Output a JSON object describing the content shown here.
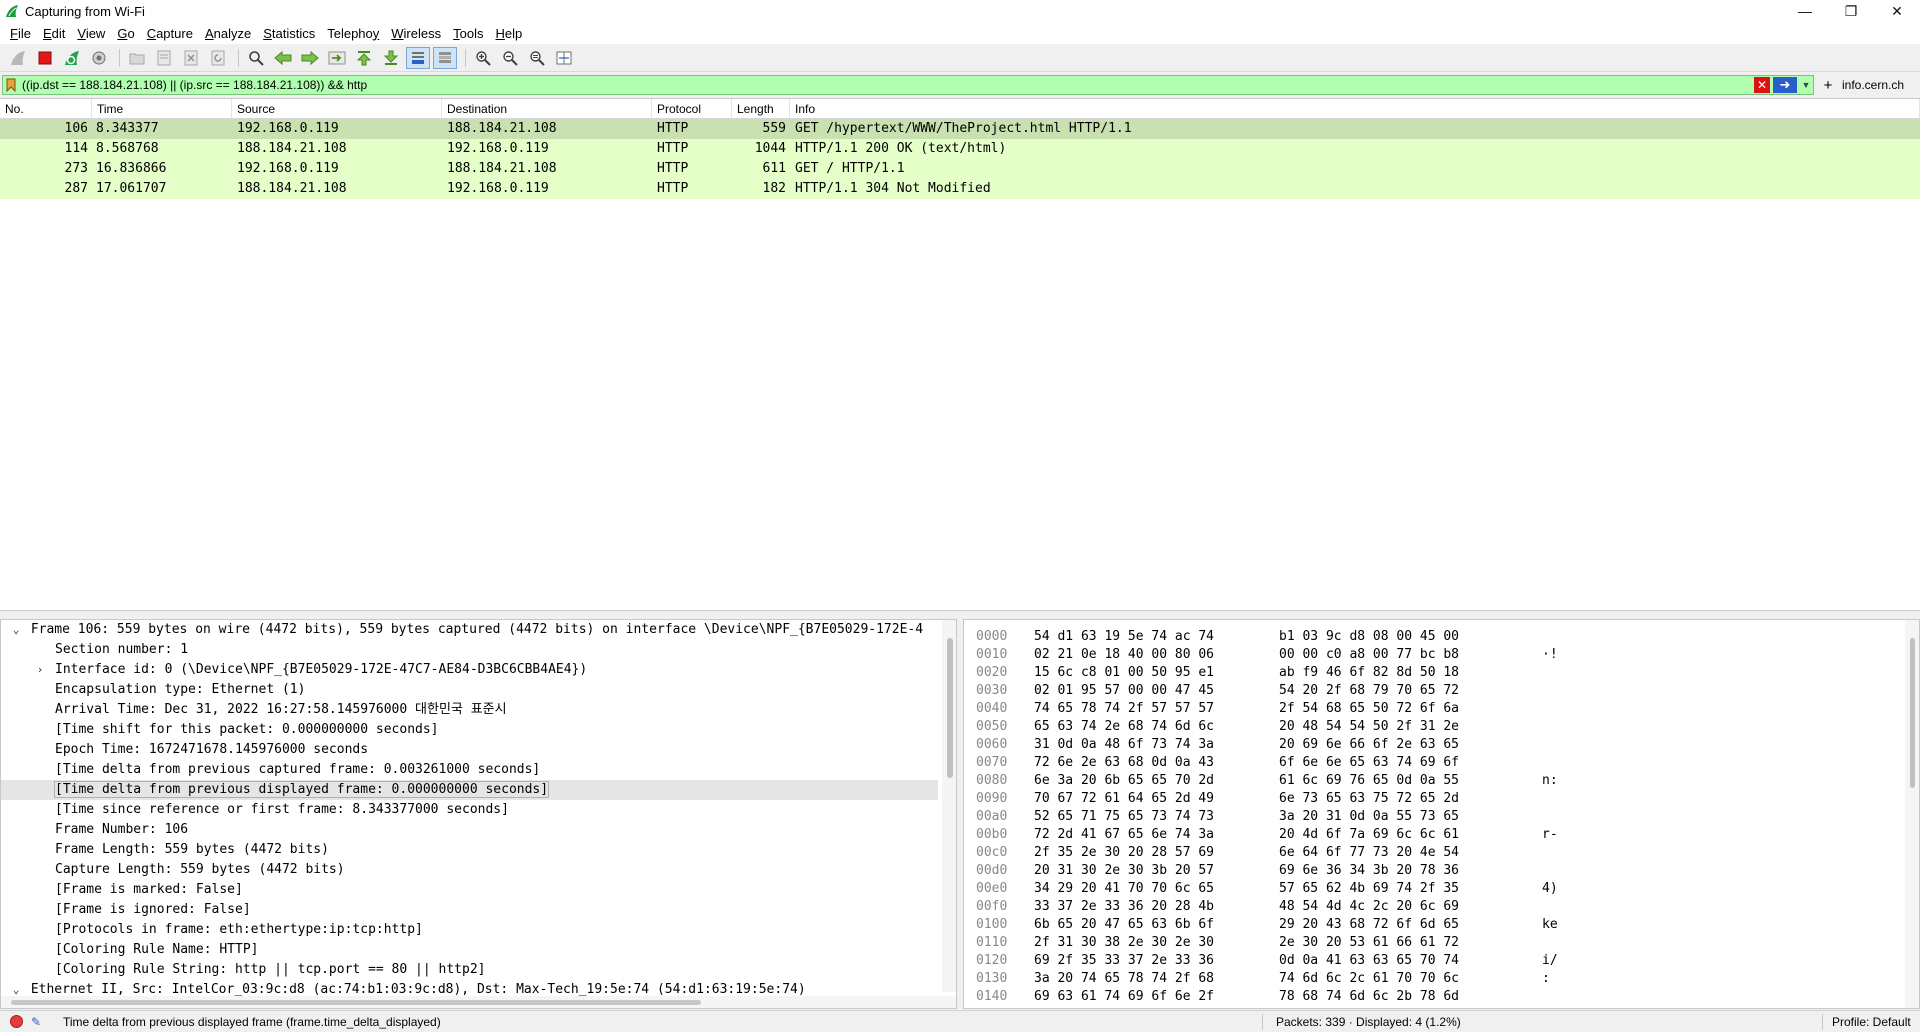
{
  "window": {
    "title": "Capturing from Wi-Fi",
    "icon": "wireshark-fin-icon",
    "controls": [
      "minimize",
      "restore",
      "close"
    ]
  },
  "menu": [
    {
      "label": "File",
      "accel": "F",
      "rest": "ile"
    },
    {
      "label": "Edit",
      "accel": "E",
      "rest": "dit"
    },
    {
      "label": "View",
      "accel": "V",
      "rest": "iew"
    },
    {
      "label": "Go",
      "accel": "G",
      "rest": "o"
    },
    {
      "label": "Capture",
      "accel": "C",
      "rest": "apture"
    },
    {
      "label": "Analyze",
      "accel": "A",
      "rest": "nalyze"
    },
    {
      "label": "Statistics",
      "accel": "S",
      "rest": "tatistics"
    },
    {
      "label": "Telephony",
      "accel": "y",
      "pre": "Teleph",
      "rest": "ny",
      "mid": "o"
    },
    {
      "label": "Wireless",
      "accel": "W",
      "rest": "ireless"
    },
    {
      "label": "Tools",
      "accel": "T",
      "rest": "ools"
    },
    {
      "label": "Help",
      "accel": "H",
      "rest": "elp"
    }
  ],
  "toolbar": {
    "icons": [
      "shark-fin-start-icon",
      "stop-capture-icon",
      "restart-capture-icon",
      "capture-options-icon",
      "open-file-icon",
      "save-file-icon",
      "close-file-icon",
      "reload-file-icon",
      "find-packet-icon",
      "go-back-icon",
      "go-forward-icon",
      "go-to-packet-icon",
      "first-packet-icon",
      "last-packet-icon",
      "autoscroll-icon",
      "colorize-icon",
      "zoom-in-icon",
      "zoom-out-icon",
      "normal-size-icon",
      "resize-columns-icon"
    ]
  },
  "filter": {
    "value": "((ip.dst == 188.184.21.108) || (ip.src == 188.184.21.108)) && http",
    "color": "#afffaf",
    "button_label": "info.cern.ch"
  },
  "packet_list": {
    "columns": [
      "No.",
      "Time",
      "Source",
      "Destination",
      "Protocol",
      "Length",
      "Info"
    ],
    "rows": [
      {
        "no": "106",
        "time": "8.343377",
        "src": "192.168.0.119",
        "dst": "188.184.21.108",
        "proto": "HTTP",
        "len": "559",
        "info": "GET /hypertext/WWW/TheProject.html HTTP/1.1",
        "selected": true
      },
      {
        "no": "114",
        "time": "8.568768",
        "src": "188.184.21.108",
        "dst": "192.168.0.119",
        "proto": "HTTP",
        "len": "1044",
        "info": "HTTP/1.1 200 OK  (text/html)",
        "selected": false
      },
      {
        "no": "273",
        "time": "16.836866",
        "src": "192.168.0.119",
        "dst": "188.184.21.108",
        "proto": "HTTP",
        "len": "611",
        "info": "GET / HTTP/1.1",
        "selected": false
      },
      {
        "no": "287",
        "time": "17.061707",
        "src": "188.184.21.108",
        "dst": "192.168.0.119",
        "proto": "HTTP",
        "len": "182",
        "info": "HTTP/1.1 304 Not Modified",
        "selected": false
      }
    ],
    "row_color": "#e4ffc7",
    "selected_color": "#c9e0b0"
  },
  "details": {
    "lines": [
      {
        "text": "Frame 106: 559 bytes on wire (4472 bits), 559 bytes captured (4472 bits) on interface \\Device\\NPF_{B7E05029-172E-4",
        "arrow": "down",
        "indent": 0
      },
      {
        "text": "Section number: 1",
        "arrow": "",
        "indent": 1
      },
      {
        "text": "Interface id: 0 (\\Device\\NPF_{B7E05029-172E-47C7-AE84-D3BC6CBB4AE4})",
        "arrow": "right",
        "indent": 1
      },
      {
        "text": "Encapsulation type: Ethernet (1)",
        "arrow": "",
        "indent": 1
      },
      {
        "text": "Arrival Time: Dec 31, 2022 16:27:58.145976000 대한민국 표준시",
        "arrow": "",
        "indent": 1
      },
      {
        "text": "[Time shift for this packet: 0.000000000 seconds]",
        "arrow": "",
        "indent": 1
      },
      {
        "text": "Epoch Time: 1672471678.145976000 seconds",
        "arrow": "",
        "indent": 1
      },
      {
        "text": "[Time delta from previous captured frame: 0.003261000 seconds]",
        "arrow": "",
        "indent": 1
      },
      {
        "text": "[Time delta from previous displayed frame: 0.000000000 seconds]",
        "arrow": "",
        "indent": 1,
        "highlight": true
      },
      {
        "text": "[Time since reference or first frame: 8.343377000 seconds]",
        "arrow": "",
        "indent": 1
      },
      {
        "text": "Frame Number: 106",
        "arrow": "",
        "indent": 1
      },
      {
        "text": "Frame Length: 559 bytes (4472 bits)",
        "arrow": "",
        "indent": 1
      },
      {
        "text": "Capture Length: 559 bytes (4472 bits)",
        "arrow": "",
        "indent": 1
      },
      {
        "text": "[Frame is marked: False]",
        "arrow": "",
        "indent": 1
      },
      {
        "text": "[Frame is ignored: False]",
        "arrow": "",
        "indent": 1
      },
      {
        "text": "[Protocols in frame: eth:ethertype:ip:tcp:http]",
        "arrow": "",
        "indent": 1
      },
      {
        "text": "[Coloring Rule Name: HTTP]",
        "arrow": "",
        "indent": 1
      },
      {
        "text": "[Coloring Rule String: http || tcp.port == 80 || http2]",
        "arrow": "",
        "indent": 1
      },
      {
        "text": "Ethernet II, Src: IntelCor_03:9c:d8 (ac:74:b1:03:9c:d8), Dst: Max-Tech_19:5e:74 (54:d1:63:19:5e:74)",
        "arrow": "down",
        "indent": 0
      }
    ]
  },
  "bytes": {
    "rows": [
      {
        "off": "0000",
        "a": "54 d1 63 19 5e 74 ac 74",
        "b": "b1 03 9c d8 08 00 45 00",
        "asc": ""
      },
      {
        "off": "0010",
        "a": "02 21 0e 18 40 00 80 06",
        "b": "00 00 c0 a8 00 77 bc b8",
        "asc": "·!"
      },
      {
        "off": "0020",
        "a": "15 6c c8 01 00 50 95 e1",
        "b": "ab f9 46 6f 82 8d 50 18",
        "asc": ""
      },
      {
        "off": "0030",
        "a": "02 01 95 57 00 00 47 45",
        "b": "54 20 2f 68 79 70 65 72",
        "asc": ""
      },
      {
        "off": "0040",
        "a": "74 65 78 74 2f 57 57 57",
        "b": "2f 54 68 65 50 72 6f 6a",
        "asc": ""
      },
      {
        "off": "0050",
        "a": "65 63 74 2e 68 74 6d 6c",
        "b": "20 48 54 54 50 2f 31 2e",
        "asc": ""
      },
      {
        "off": "0060",
        "a": "31 0d 0a 48 6f 73 74 3a",
        "b": "20 69 6e 66 6f 2e 63 65",
        "asc": ""
      },
      {
        "off": "0070",
        "a": "72 6e 2e 63 68 0d 0a 43",
        "b": "6f 6e 6e 65 63 74 69 6f",
        "asc": ""
      },
      {
        "off": "0080",
        "a": "6e 3a 20 6b 65 65 70 2d",
        "b": "61 6c 69 76 65 0d 0a 55",
        "asc": "n:"
      },
      {
        "off": "0090",
        "a": "70 67 72 61 64 65 2d 49",
        "b": "6e 73 65 63 75 72 65 2d",
        "asc": ""
      },
      {
        "off": "00a0",
        "a": "52 65 71 75 65 73 74 73",
        "b": "3a 20 31 0d 0a 55 73 65",
        "asc": ""
      },
      {
        "off": "00b0",
        "a": "72 2d 41 67 65 6e 74 3a",
        "b": "20 4d 6f 7a 69 6c 6c 61",
        "asc": "r-"
      },
      {
        "off": "00c0",
        "a": "2f 35 2e 30 20 28 57 69",
        "b": "6e 64 6f 77 73 20 4e 54",
        "asc": ""
      },
      {
        "off": "00d0",
        "a": "20 31 30 2e 30 3b 20 57",
        "b": "69 6e 36 34 3b 20 78 36",
        "asc": ""
      },
      {
        "off": "00e0",
        "a": "34 29 20 41 70 70 6c 65",
        "b": "57 65 62 4b 69 74 2f 35",
        "asc": "4)"
      },
      {
        "off": "00f0",
        "a": "33 37 2e 33 36 20 28 4b",
        "b": "48 54 4d 4c 2c 20 6c 69",
        "asc": ""
      },
      {
        "off": "0100",
        "a": "6b 65 20 47 65 63 6b 6f",
        "b": "29 20 43 68 72 6f 6d 65",
        "asc": "ke"
      },
      {
        "off": "0110",
        "a": "2f 31 30 38 2e 30 2e 30",
        "b": "2e 30 20 53 61 66 61 72",
        "asc": ""
      },
      {
        "off": "0120",
        "a": "69 2f 35 33 37 2e 33 36",
        "b": "0d 0a 41 63 63 65 70 74",
        "asc": "i/"
      },
      {
        "off": "0130",
        "a": "3a 20 74 65 78 74 2f 68",
        "b": "74 6d 6c 2c 61 70 70 6c",
        "asc": ":"
      },
      {
        "off": "0140",
        "a": "69 63 61 74 69 6f 6e 2f",
        "b": "78 68 74 6d 6c 2b 78 6d",
        "asc": ""
      }
    ]
  },
  "status": {
    "text": "Time delta from previous displayed frame (frame.time_delta_displayed)",
    "packets": "Packets: 339 · Displayed: 4 (1.2%)",
    "profile": "Profile: Default"
  }
}
